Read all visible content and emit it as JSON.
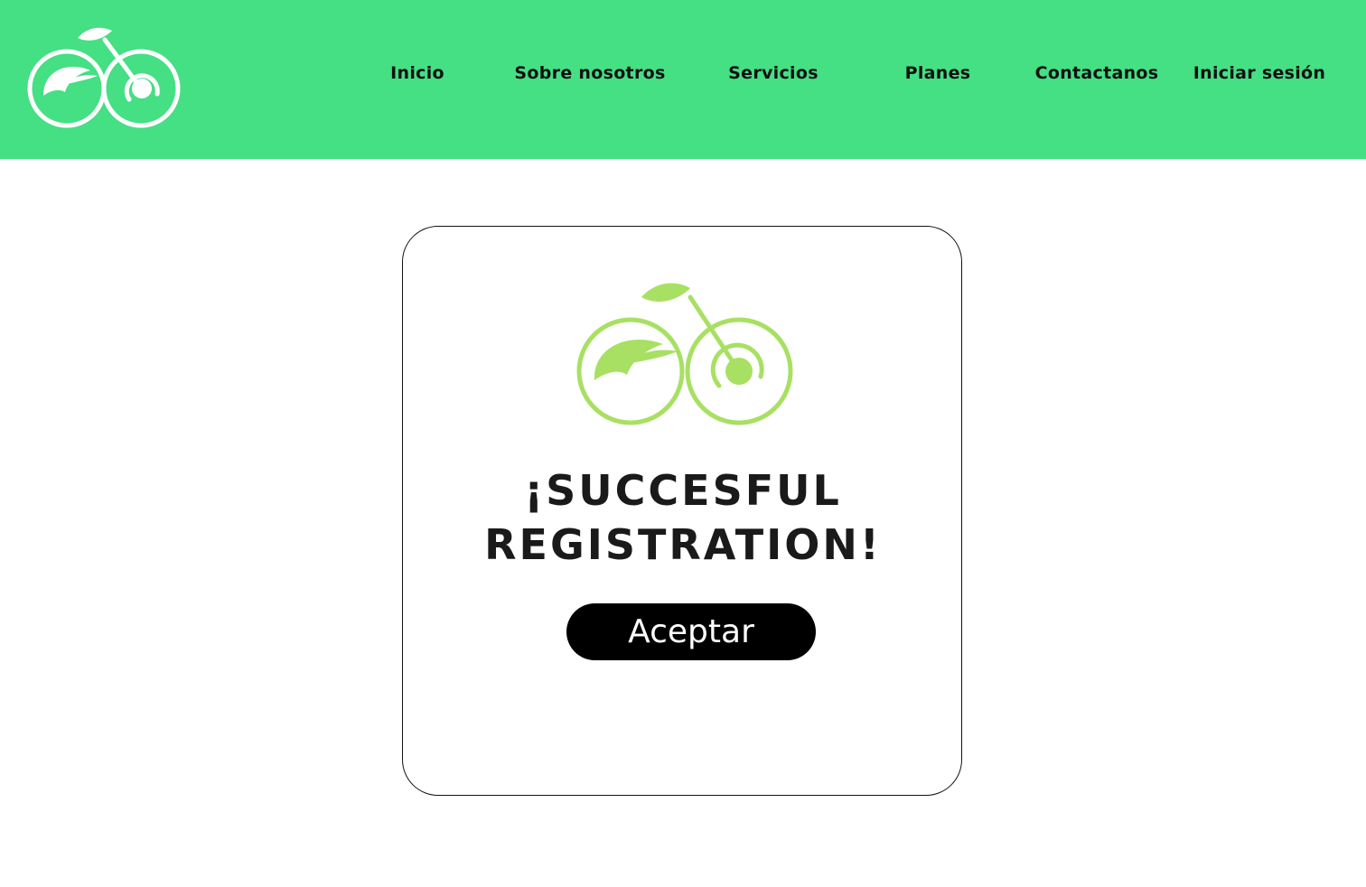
{
  "colors": {
    "header_background": "#45df84",
    "logo_header": "#ffffff",
    "logo_card": "#a8e063",
    "button_background": "#000000",
    "button_text": "#ffffff",
    "title_text": "#1a1a1a"
  },
  "header": {
    "logo_icon": "bicycle-leaf-logo",
    "nav": {
      "inicio": "Inicio",
      "sobre": "Sobre nosotros",
      "servicios": "Servicios",
      "planes": "Planes",
      "contacto": "Contactanos",
      "login": "Iniciar sesión"
    }
  },
  "card": {
    "logo_icon": "bicycle-leaf-logo",
    "title_line1": "¡SUCCESFUL",
    "title_line2": "REGISTRATION!",
    "button_label": "Aceptar"
  }
}
